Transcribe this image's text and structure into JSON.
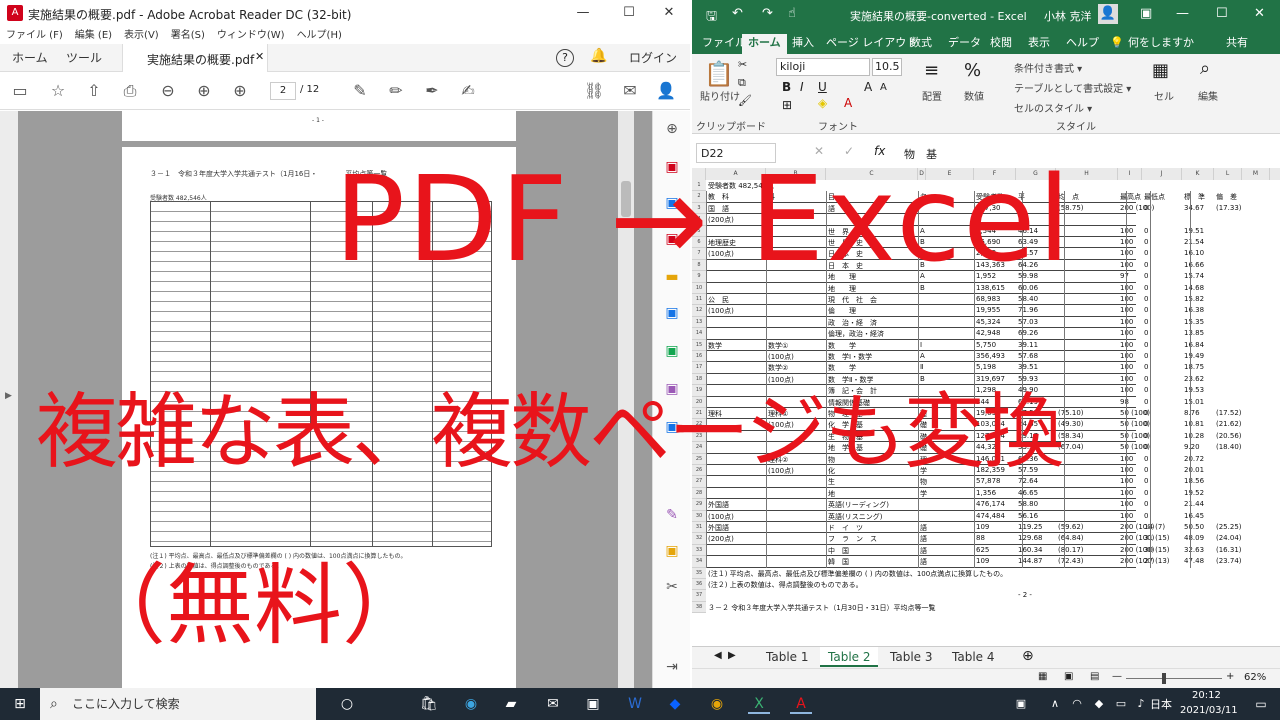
{
  "acrobat": {
    "title": "実施結果の概要.pdf - Adobe Acrobat Reader DC (32-bit)",
    "menu": [
      "ファイル (F)",
      "編集 (E)",
      "表示(V)",
      "署名(S)",
      "ウィンドウ(W)",
      "ヘルプ(H)"
    ],
    "tab_home": "ホーム",
    "tab_tools": "ツール",
    "tab_doc": "実施結果の概要.pdf",
    "login": "ログイン",
    "page_current": "2",
    "page_total": "/ 12",
    "page1_num": "- 1 -",
    "doc_heading": "３－１　令和３年度大学入学共通テスト（1月16日・　　　　平均点等一覧",
    "doc_count": "受験者数 482,546人",
    "doc_note1": "(注１) 平均点、最高点、最低点及び標準偏差欄の (   ) 内の数値は、100点満点に換算したもの。",
    "doc_note2": "(注２) 上表の数値は、得点調整後のものである。"
  },
  "excel": {
    "title": "実施結果の概要-converted  -  Excel",
    "user": "小林 克洋",
    "tabs": [
      "ファイル",
      "ホーム",
      "挿入",
      "ページ レイアウト",
      "数式",
      "データ",
      "校閲",
      "表示",
      "ヘルプ",
      "何をしますか",
      "共有"
    ],
    "font_name": "kiloji",
    "font_size": "10.5",
    "cond_format": "条件付き書式 ▾",
    "table_format": "テーブルとして書式設定 ▾",
    "cell_style": "セルのスタイル ▾",
    "grp_clip": "クリップボード",
    "grp_font": "フォント",
    "grp_style": "スタイル",
    "paste": "貼り付け",
    "align": "配置",
    "number": "数値",
    "cells": "セル",
    "edit": "編集",
    "name_box": "D22",
    "formula": "物　基",
    "columns": [
      "A",
      "B",
      "C",
      "D",
      "E",
      "F",
      "G",
      "H",
      "I",
      "J",
      "K",
      "L",
      "M",
      "N",
      "O",
      "P",
      "Q"
    ],
    "rows": [
      {
        "r": "1",
        "a": "受験者数 482,546人"
      },
      {
        "r": "2",
        "a": "教　科",
        "b": "科",
        "c": "目",
        "d": "名",
        "e": "受験者数",
        "f": "平",
        "g": "均　点",
        "h": "最高点",
        "i": "最低点",
        "j": "標　準",
        "k": "偏　差"
      },
      {
        "r": "3",
        "a": "国　語",
        "c": "語",
        "e": "457,30",
        "f": "",
        "g": "(58.75)",
        "h": "200 (100)",
        "i": "0",
        "j": "34.67",
        "k": "(17.33)"
      },
      {
        "r": "4",
        "a": "(200点)"
      },
      {
        "r": "5",
        "c": "世　界　史",
        "d": "A",
        "e": "1,544",
        "f": "46.14",
        "h": "100",
        "i": "0",
        "j": "19.51"
      },
      {
        "r": "6",
        "a": "地理歴史",
        "c": "世　界　史",
        "d": "B",
        "e": "85,690",
        "f": "63.49",
        "h": "100",
        "i": "0",
        "j": "21.54"
      },
      {
        "r": "7",
        "a": "(100点)",
        "c": "日　本　史",
        "d": "A",
        "e": "2,363",
        "f": "49.57",
        "h": "100",
        "i": "0",
        "j": "16.10"
      },
      {
        "r": "8",
        "c": "日　本　史",
        "d": "B",
        "e": "143,363",
        "f": "64.26",
        "h": "100",
        "i": "0",
        "j": "16.66"
      },
      {
        "r": "9",
        "c": "地　　理",
        "d": "A",
        "e": "1,952",
        "f": "59.98",
        "h": "97",
        "i": "0",
        "j": "15.74"
      },
      {
        "r": "10",
        "c": "地　　理",
        "d": "B",
        "e": "138,615",
        "f": "60.06",
        "h": "100",
        "i": "0",
        "j": "14.68"
      },
      {
        "r": "11",
        "a": "公　民",
        "c": "現　代　社　会",
        "e": "68,983",
        "f": "58.40",
        "h": "100",
        "i": "0",
        "j": "15.82"
      },
      {
        "r": "12",
        "a": "(100点)",
        "c": "倫　　理",
        "e": "19,955",
        "f": "71.96",
        "h": "100",
        "i": "0",
        "j": "16.38"
      },
      {
        "r": "13",
        "c": "政　治・経　済",
        "e": "45,324",
        "f": "57.03",
        "h": "100",
        "i": "0",
        "j": "15.35"
      },
      {
        "r": "14",
        "c": "倫理，政治・経済",
        "e": "42,948",
        "f": "69.26",
        "h": "100",
        "i": "0",
        "j": "13.85"
      },
      {
        "r": "15",
        "a": "数学",
        "b": "数学①",
        "c": "数　　学",
        "d": "Ⅰ",
        "e": "5,750",
        "f": "39.11",
        "h": "100",
        "i": "0",
        "j": "16.84"
      },
      {
        "r": "16",
        "b": "(100点)",
        "c": "数　学Ⅰ・数学",
        "d": "A",
        "e": "356,493",
        "f": "57.68",
        "h": "100",
        "i": "0",
        "j": "19.49"
      },
      {
        "r": "17",
        "b": "数学②",
        "c": "数　　学",
        "d": "Ⅱ",
        "e": "5,198",
        "f": "39.51",
        "h": "100",
        "i": "0",
        "j": "18.75"
      },
      {
        "r": "18",
        "b": "(100点)",
        "c": "数　学Ⅱ・数学",
        "d": "B",
        "e": "319,697",
        "f": "59.93",
        "h": "100",
        "i": "0",
        "j": "23.62"
      },
      {
        "r": "19",
        "c": "簿　記・会　計",
        "e": "1,298",
        "f": "49.90",
        "h": "100",
        "i": "0",
        "j": "19.53"
      },
      {
        "r": "20",
        "c": "情報関係基礎",
        "e": "344",
        "f": "61.19",
        "h": "98",
        "i": "0",
        "j": "15.01"
      },
      {
        "r": "21",
        "a": "理科",
        "b": "理科①",
        "c": "物　理　基",
        "d": "礎",
        "e": "19,094",
        "f": "37.55",
        "g": "(75.10)",
        "h": "50 (100)",
        "i": "0",
        "j": "8.76",
        "k": "(17.52)"
      },
      {
        "r": "22",
        "b": "(100点)",
        "c": "化　学　基",
        "d": "礎",
        "e": "103,074",
        "f": "24.65",
        "g": "(49.30)",
        "h": "50 (100)",
        "i": "0",
        "j": "10.81",
        "k": "(21.62)"
      },
      {
        "r": "23",
        "c": "生　物　基",
        "d": "礎",
        "e": "127,924",
        "f": "29.17",
        "g": "(58.34)",
        "h": "50 (100)",
        "i": "0",
        "j": "10.28",
        "k": "(20.56)"
      },
      {
        "r": "24",
        "c": "地　学　基",
        "d": "礎",
        "e": "44,320",
        "f": "33.52",
        "g": "(67.04)",
        "h": "50 (100)",
        "i": "0",
        "j": "9.20",
        "k": "(18.40)"
      },
      {
        "r": "25",
        "b": "理科②",
        "c": "物",
        "d": "理",
        "e": "146,041",
        "f": "62.36",
        "h": "100",
        "i": "0",
        "j": "20.72"
      },
      {
        "r": "26",
        "b": "(100点)",
        "c": "化",
        "d": "学",
        "e": "182,359",
        "f": "57.59",
        "h": "100",
        "i": "0",
        "j": "20.01"
      },
      {
        "r": "27",
        "c": "生",
        "d": "物",
        "e": "57,878",
        "f": "72.64",
        "h": "100",
        "i": "0",
        "j": "18.56"
      },
      {
        "r": "28",
        "c": "地",
        "d": "学",
        "e": "1,356",
        "f": "46.65",
        "h": "100",
        "i": "0",
        "j": "19.52"
      },
      {
        "r": "29",
        "a": "外国語",
        "c": "英語(リーディング)",
        "e": "476,174",
        "f": "58.80",
        "h": "100",
        "i": "0",
        "j": "21.44"
      },
      {
        "r": "30",
        "a": "(100点)",
        "c": "英語(リスニング)",
        "e": "474,484",
        "f": "56.16",
        "h": "100",
        "i": "0",
        "j": "16.45"
      },
      {
        "r": "31",
        "a": "外国語",
        "c": "ド　イ　ツ",
        "d": "語",
        "e": "109",
        "f": "119.25",
        "g": "(59.62)",
        "h": "200 (100)",
        "i": "14 (7)",
        "j": "50.50",
        "k": "(25.25)"
      },
      {
        "r": "32",
        "a": "(200点)",
        "c": "フ　ラ　ン　ス",
        "d": "語",
        "e": "88",
        "f": "129.68",
        "g": "(64.84)",
        "h": "200 (100)",
        "i": "31 (15)",
        "j": "48.09",
        "k": "(24.04)"
      },
      {
        "r": "33",
        "c": "中　国",
        "d": "語",
        "e": "625",
        "f": "160.34",
        "g": "(80.17)",
        "h": "200 (100)",
        "i": "30 (15)",
        "j": "32.63",
        "k": "(16.31)"
      },
      {
        "r": "34",
        "c": "韓　国",
        "d": "語",
        "e": "109",
        "f": "144.87",
        "g": "(72.43)",
        "h": "200 (100)",
        "i": "27 (13)",
        "j": "47.48",
        "k": "(23.74)"
      },
      {
        "r": "35",
        "a": "(注１) 平均点、最高点、最低点及び標準偏差欄の (  ) 内の数値は、100点満点に換算したもの。"
      },
      {
        "r": "36",
        "a": "(注２) 上表の数値は、得点調整後のものである。"
      },
      {
        "r": "37",
        "a": "",
        "f": "- 2 -"
      },
      {
        "r": "38",
        "a": "３－２ 令和３年度大学入学共通テスト（1月30日・31日）平均点等一覧"
      }
    ],
    "sheets": [
      "Table 1",
      "Table 2",
      "Table 3",
      "Table 4"
    ],
    "active_sheet": 1,
    "zoom": "62%"
  },
  "taskbar": {
    "search": "ここに入力して検索",
    "time": "20:12",
    "date": "2021/03/11",
    "lang": "日本"
  },
  "overlay": {
    "line1": "PDF → Excel",
    "line2": "複雑な表、複数ページも変換",
    "line3": "（無料）"
  },
  "colors": {
    "excel_green": "#217346",
    "overlay_red": "#e8141b",
    "acrobat_red": "#d0021b"
  }
}
